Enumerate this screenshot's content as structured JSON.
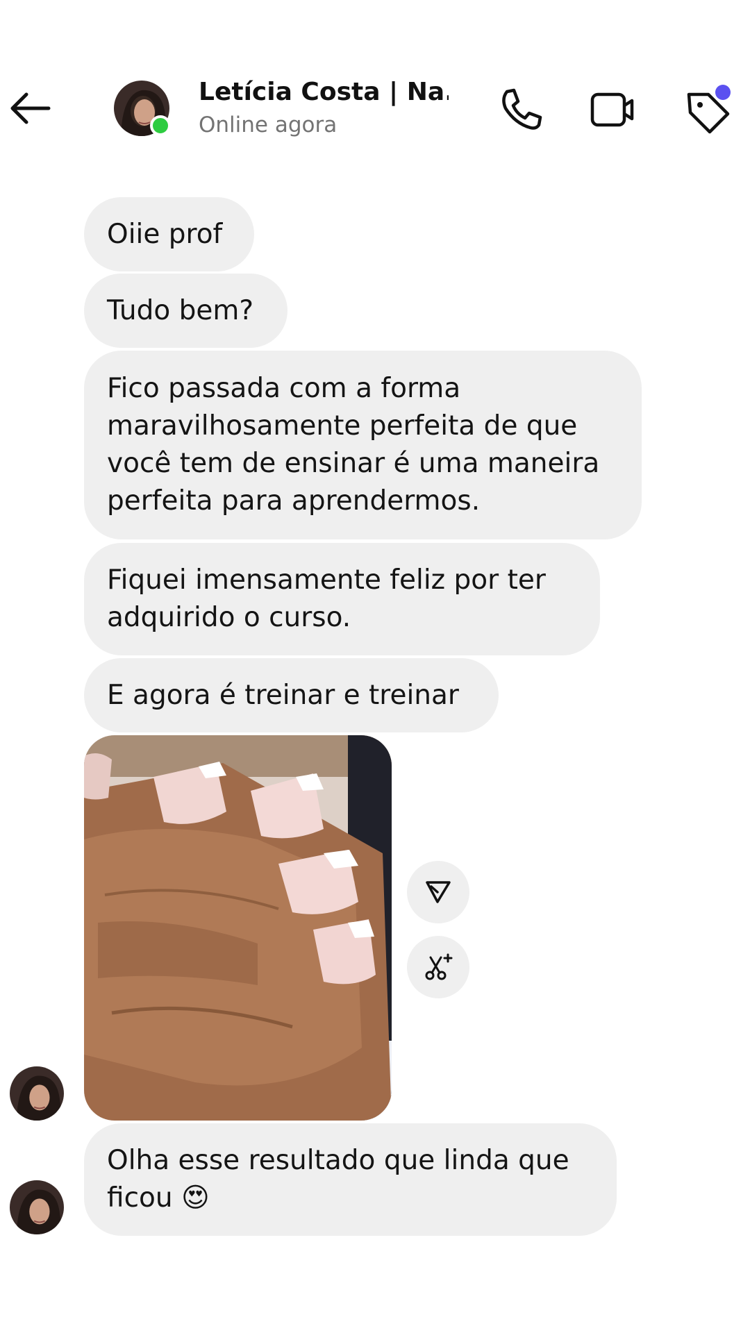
{
  "header": {
    "contact_name": "Letícia Costa | Na...",
    "status": "Online agora",
    "icons": [
      "back-arrow-icon",
      "phone-icon",
      "video-camera-icon",
      "tag-icon"
    ]
  },
  "messages": [
    {
      "lines": [
        "Oiie prof"
      ]
    },
    {
      "lines": [
        "Tudo bem?"
      ]
    },
    {
      "lines": [
        "Fico passada com a forma",
        "maravilhosamente perfeita de que",
        "você tem de ensinar é uma maneira",
        "perfeita para aprendermos."
      ]
    },
    {
      "lines": [
        "Fiquei imensamente feliz por ter",
        "adquirido o curso."
      ]
    },
    {
      "lines": [
        "E agora é treinar e treinar"
      ]
    },
    {
      "lines": [
        "Olha esse resultado que linda que",
        "ficou 😍"
      ]
    }
  ],
  "photo_actions": [
    "share-icon",
    "scissors-sparkle-icon"
  ],
  "colors": {
    "bubble": "#efefef",
    "online": "#2ecc40",
    "notification": "#5b51f0",
    "status_text": "#737373"
  }
}
